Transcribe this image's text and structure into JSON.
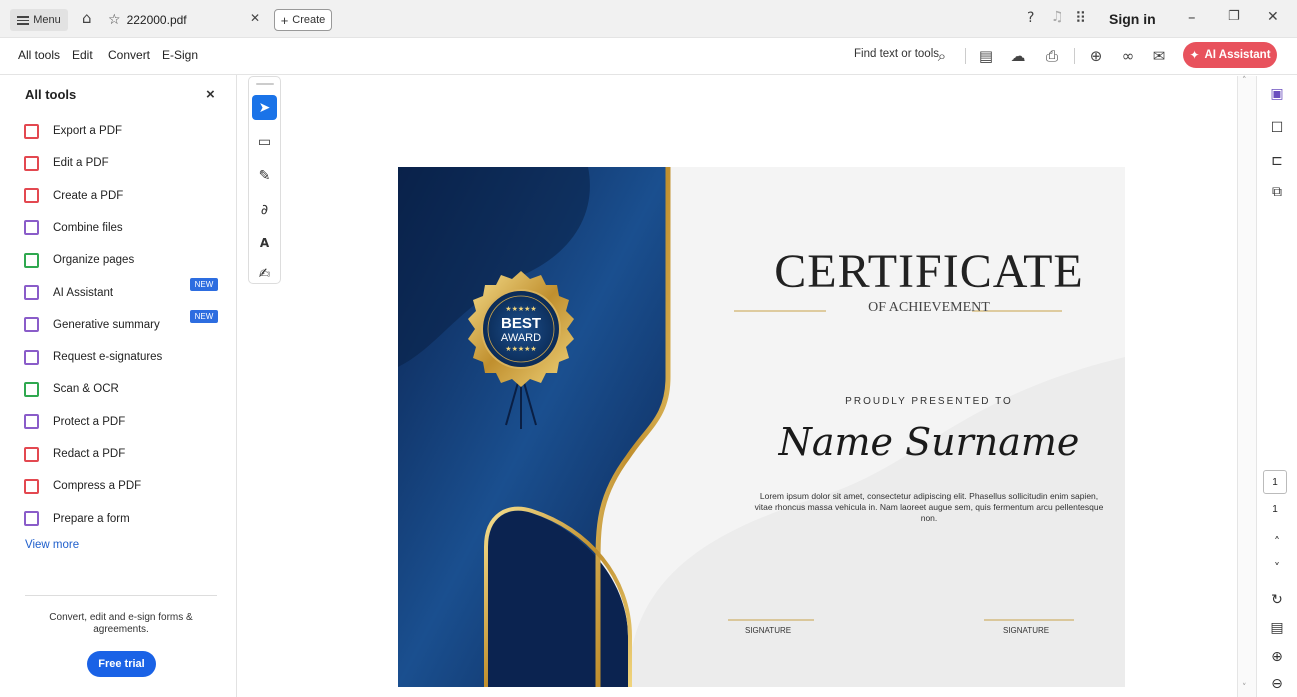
{
  "titlebar": {
    "menu_label": "Menu",
    "tab_title": "222000.pdf",
    "create_label": "Create",
    "sign_in": "Sign in"
  },
  "toolbar": {
    "menus": [
      "All tools",
      "Edit",
      "Convert",
      "E-Sign"
    ],
    "find_label": "Find text or tools",
    "ai_assistant_label": "AI Assistant"
  },
  "left_panel": {
    "title": "All tools",
    "tools": [
      {
        "label": "Export a PDF",
        "color": "#e34850",
        "icon": "export-pdf-icon"
      },
      {
        "label": "Edit a PDF",
        "color": "#e34850",
        "icon": "edit-pdf-icon"
      },
      {
        "label": "Create a PDF",
        "color": "#e34850",
        "icon": "create-pdf-icon"
      },
      {
        "label": "Combine files",
        "color": "#8a5cc9",
        "icon": "combine-files-icon"
      },
      {
        "label": "Organize pages",
        "color": "#2fa84f",
        "icon": "organize-pages-icon"
      },
      {
        "label": "AI Assistant",
        "color": "#8a5cc9",
        "icon": "ai-assistant-icon",
        "badge": "NEW"
      },
      {
        "label": "Generative summary",
        "color": "#8a5cc9",
        "icon": "generative-summary-icon",
        "badge": "NEW"
      },
      {
        "label": "Request e-signatures",
        "color": "#8a5cc9",
        "icon": "e-signature-icon"
      },
      {
        "label": "Scan & OCR",
        "color": "#2fa84f",
        "icon": "scan-ocr-icon"
      },
      {
        "label": "Protect a PDF",
        "color": "#8a5cc9",
        "icon": "protect-pdf-icon"
      },
      {
        "label": "Redact a PDF",
        "color": "#e34850",
        "icon": "redact-pdf-icon"
      },
      {
        "label": "Compress a PDF",
        "color": "#e34850",
        "icon": "compress-pdf-icon"
      },
      {
        "label": "Prepare a form",
        "color": "#8a5cc9",
        "icon": "prepare-form-icon"
      }
    ],
    "view_more": "View more",
    "promo_text": "Convert, edit and e-sign forms & agreements.",
    "free_trial": "Free trial"
  },
  "certificate": {
    "badge_top": "BEST",
    "badge_bottom": "AWARD",
    "badge_stars": "★★★★★",
    "title": "CERTIFICATE",
    "subtitle": "OF ACHIEVEMENT",
    "presented_to": "PROUDLY PRESENTED TO",
    "name": "Name Surname",
    "body": "Lorem ipsum dolor sit amet, consectetur adipiscing elit. Phasellus sollicitudin enim sapien, vitae rhoncus massa vehicula in. Nam laoreet augue sem, quis fermentum arcu pellentesque non.",
    "signature_left": "SIGNATURE",
    "signature_right": "SIGNATURE",
    "navy": "#0d2d5e",
    "gold": "#c9a24a"
  },
  "page_nav": {
    "current_page": "1",
    "total_pages": "1"
  },
  "colors": {
    "accent": "#1a73e8",
    "ai_button": "#e8525d",
    "trial_button": "#1a62e6"
  }
}
